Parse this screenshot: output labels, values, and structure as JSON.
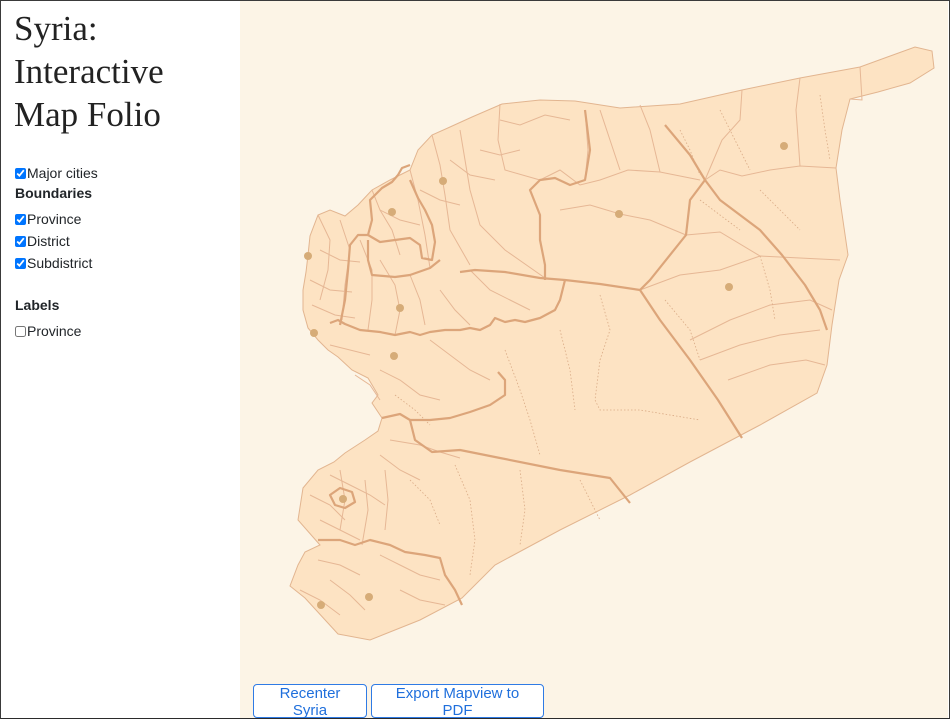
{
  "sidebar": {
    "title": "Syria: Interactive Map Folio",
    "layers": {
      "major_cities": {
        "label": "Major cities",
        "checked": true
      }
    },
    "boundaries": {
      "heading": "Boundaries",
      "province": {
        "label": "Province",
        "checked": true
      },
      "district": {
        "label": "District",
        "checked": true
      },
      "subdistrict": {
        "label": "Subdistrict",
        "checked": true
      }
    },
    "labels": {
      "heading": "Labels",
      "province": {
        "label": "Province",
        "checked": false
      }
    }
  },
  "map": {
    "colors": {
      "background": "#fcf4e6",
      "country_fill": "#fde3c3",
      "province_border": "#dca57a",
      "city_marker": "#d6ac78"
    },
    "major_city_count": 10
  },
  "buttons": {
    "recenter": "Recenter Syria",
    "export": "Export Mapview to PDF"
  }
}
